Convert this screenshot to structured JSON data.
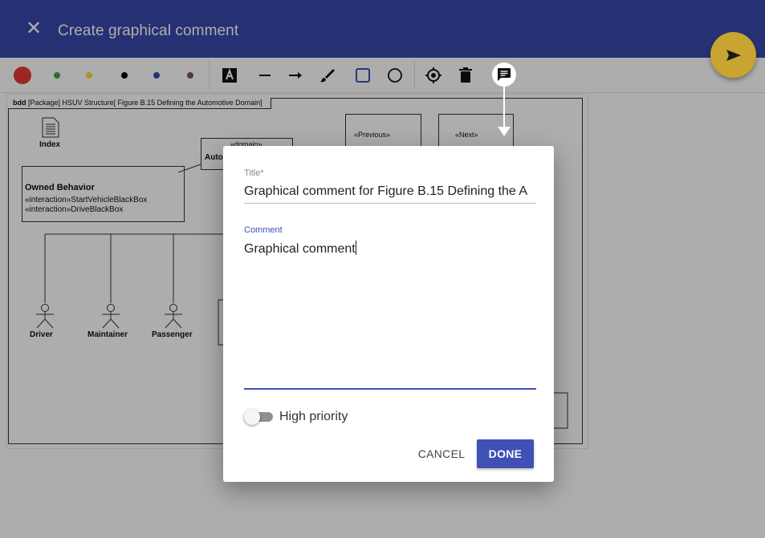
{
  "header": {
    "close_icon": "close-icon",
    "title": "Create graphical comment",
    "send_icon": "send-icon",
    "background": "#3949ab",
    "fab_color": "#c8a430"
  },
  "toolbar": {
    "colors": [
      {
        "name": "red",
        "hex": "#e53935",
        "selected": true
      },
      {
        "name": "green",
        "hex": "#43a047"
      },
      {
        "name": "yellow",
        "hex": "#fdd835"
      },
      {
        "name": "black",
        "hex": "#000000"
      },
      {
        "name": "blue",
        "hex": "#3949ab"
      },
      {
        "name": "brown",
        "hex": "#795548"
      }
    ],
    "tools": [
      "text-tool-icon",
      "line-tool-icon",
      "arrow-tool-icon",
      "brush-tool-icon",
      "rectangle-tool-icon",
      "circle-tool-icon",
      "target-icon",
      "delete-icon",
      "comment-icon"
    ],
    "selected_tool": "rectangle-tool-icon"
  },
  "diagram": {
    "frame_kind": "bdd",
    "frame_title": "[Package] HSUV Structure[ Figure B.15 Defining the Automotive Domain]",
    "index_label": "Index",
    "owned_behavior_title": "Owned Behavior",
    "owned_behavior_items": [
      "«interaction»StartVehicleBlackBox",
      "«interaction»DriveBlackBox"
    ],
    "domain_stereotype": "«domain»",
    "domain_name_partial": "Auto",
    "previous_stereotype": "«Previous»",
    "next_stereotype": "«Next»",
    "actors": [
      "Driver",
      "Maintainer",
      "Passenger"
    ]
  },
  "dialog": {
    "title_label": "Title*",
    "title_value": "Graphical comment for Figure B.15 Defining the A",
    "comment_label": "Comment",
    "comment_value": "Graphical comment",
    "toggle_label": "High priority",
    "toggle_on": false,
    "cancel_label": "CANCEL",
    "done_label": "DONE",
    "accent": "#3f51b5"
  }
}
